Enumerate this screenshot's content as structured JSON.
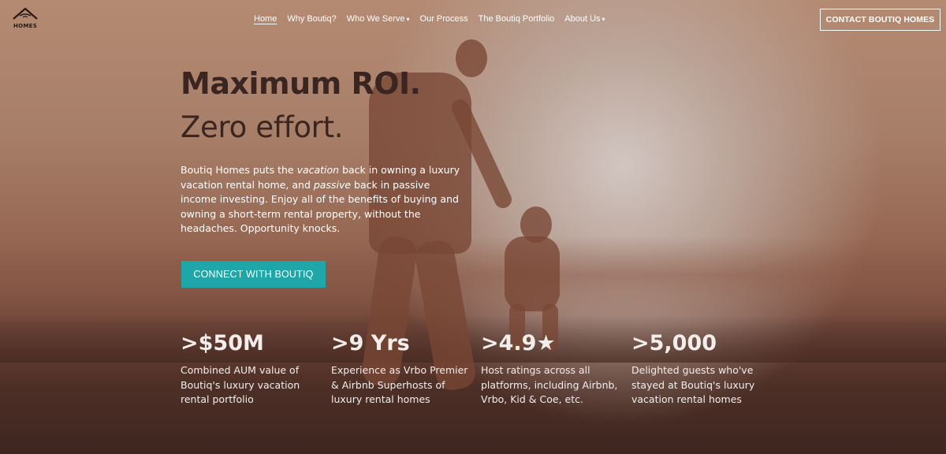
{
  "brand": {
    "logo_text": "HOMES"
  },
  "nav": {
    "items": [
      {
        "label": "Home"
      },
      {
        "label": "Why Boutiq?"
      },
      {
        "label": "Who We Serve"
      },
      {
        "label": "Our Process"
      },
      {
        "label": "The Boutiq Portfolio"
      },
      {
        "label": "About Us"
      }
    ],
    "contact_label": "CONTACT BOUTIQ HOMES"
  },
  "hero": {
    "headline": "Maximum ROI.",
    "subheadline": "Zero effort.",
    "intro": {
      "p1": "Boutiq Homes puts the ",
      "em1": "vacation",
      "p2": " back in owning a luxury vacation rental home, and ",
      "em2": "passive",
      "p3": " back in passive income investing. Enjoy all of the benefits of buying and owning a short-term rental property, without the headaches. Opportunity knocks."
    },
    "cta_label": "CONNECT WITH BOUTIQ"
  },
  "stats": [
    {
      "value": ">$50M",
      "desc": "Combined AUM value of Boutiq's luxury vacation rental portfolio"
    },
    {
      "value": ">9 Yrs",
      "desc": "Experience as Vrbo Premier & Airbnb Superhosts of luxury rental homes"
    },
    {
      "value": ">4.9★",
      "desc": "Host ratings across all platforms, including Airbnb, Vrbo, Kid & Coe, etc."
    },
    {
      "value": ">5,000",
      "desc": "Delighted guests who've stayed at Boutiq's luxury vacation rental homes"
    }
  ],
  "colors": {
    "accent": "#1fa6a8",
    "headline": "#3b2520",
    "text_light": "#ffffff"
  },
  "icons": {
    "logo": "house-roof-icon",
    "dropdown": "chevron-down-icon"
  }
}
